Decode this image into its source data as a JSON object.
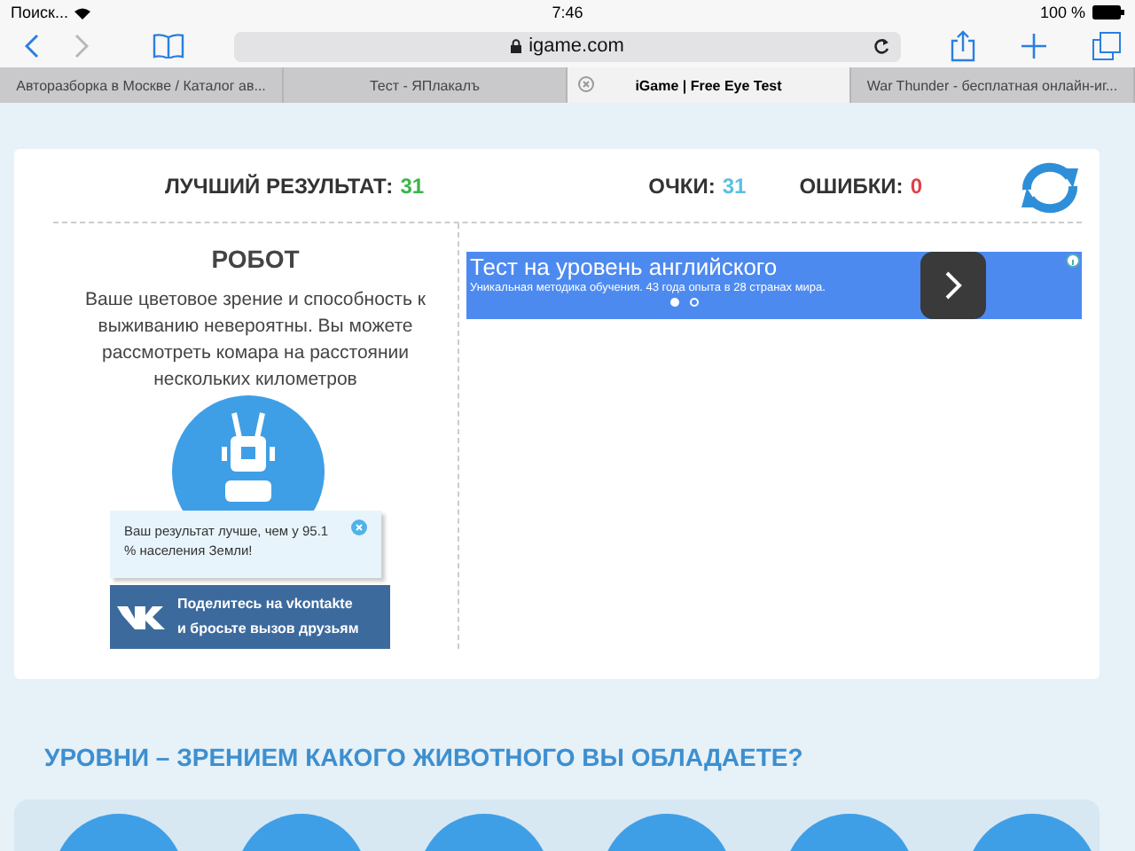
{
  "status_bar": {
    "carrier": "Поиск...",
    "time": "7:46",
    "battery": "100 %"
  },
  "toolbar": {
    "nav": [
      {
        "kind": "back",
        "disabled": false
      },
      {
        "kind": "forward",
        "disabled": true
      }
    ],
    "url": "igame.com"
  },
  "tabs": [
    {
      "label": "Авторазборка в Москве / Каталог ав...",
      "selected": false
    },
    {
      "label": "Тест - ЯПлакалъ",
      "selected": false
    },
    {
      "label": "iGame | Free Eye Test",
      "selected": true
    },
    {
      "label": "War Thunder - бесплатная онлайн-иг...",
      "selected": false
    }
  ],
  "score": {
    "best_label": "ЛУЧШИЙ РЕЗУЛЬТАТ:",
    "best": "31",
    "points_label": "ОЧКИ:",
    "points": "31",
    "errors_label": "ОШИБКИ:",
    "errors": "0"
  },
  "result": {
    "title": "РОБОТ",
    "description": "Ваше цветовое зрение и способность к выживанию невероятны. Вы можете рассмотреть комара на расстоянии нескольких километров",
    "popup": "Ваш результат лучше, чем у 95.1 % населения Земли!",
    "share": [
      "Поделитесь на vkontakte",
      "и бросьте вызов друзьям"
    ]
  },
  "ad": {
    "title": "Тест на уровень английского",
    "subtitle": "Уникальная методика обучения. 43 года опыта в 28 странах мира.",
    "dots": [
      {
        "selected": true
      },
      {
        "selected": false
      }
    ]
  },
  "levels": {
    "heading": "УРОВНИ – ЗРЕНИЕМ КАКОГО ЖИВОТНОГО ВЫ ОБЛАДАЕТЕ?"
  }
}
